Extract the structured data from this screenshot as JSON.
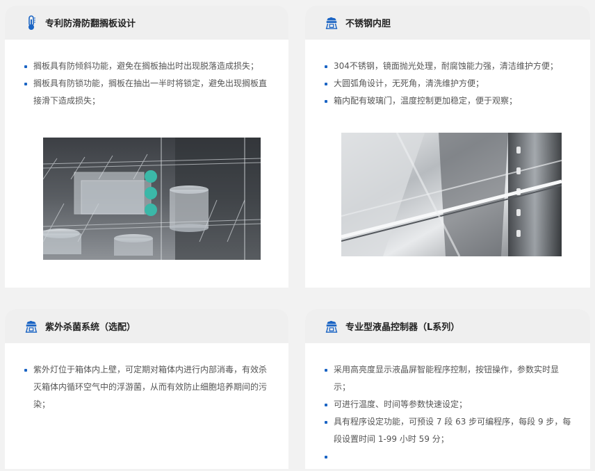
{
  "cards": [
    {
      "icon": "thermometer-icon",
      "title": "专利防滑防翻搁板设计",
      "bullets": [
        "搁板具有防倾斜功能，避免在搁板抽出时出现脱落造成损失；",
        "搁板具有防锁功能，搁板在抽出一半时将锁定，避免出现搁板直接滑下造成损失；"
      ]
    },
    {
      "icon": "incubator-icon",
      "title": "不锈钢内胆",
      "bullets": [
        "304不锈钢，镜面抛光处理，耐腐蚀能力强，清洁维护方便；",
        "大圆弧角设计，无死角，清洗维护方便；",
        "箱内配有玻璃门，温度控制更加稳定，便于观察；"
      ]
    },
    {
      "icon": "incubator-icon",
      "title": "紫外杀菌系统（选配）",
      "bullets": [
        "紫外灯位于箱体内上壁，可定期对箱体内进行内部消毒，有效杀灭箱体内循环空气中的浮游菌，从而有效防止细胞培养期间的污染；"
      ]
    },
    {
      "icon": "incubator-icon",
      "title": "专业型液晶控制器（L系列）",
      "bullets": [
        "采用高亮度显示液晶屏智能程序控制，按钮操作，参数实时显示；",
        "可进行温度、时间等参数快速设定；",
        "具有程序设定功能，可预设 7 段 63 步可编程序，每段 9 步，每段设置时间 1-99 小时 59 分；",
        ""
      ]
    }
  ],
  "colors": {
    "accent": "#1a64c4",
    "header_bg": "#efefef",
    "page_bg": "#f2f2f2"
  }
}
